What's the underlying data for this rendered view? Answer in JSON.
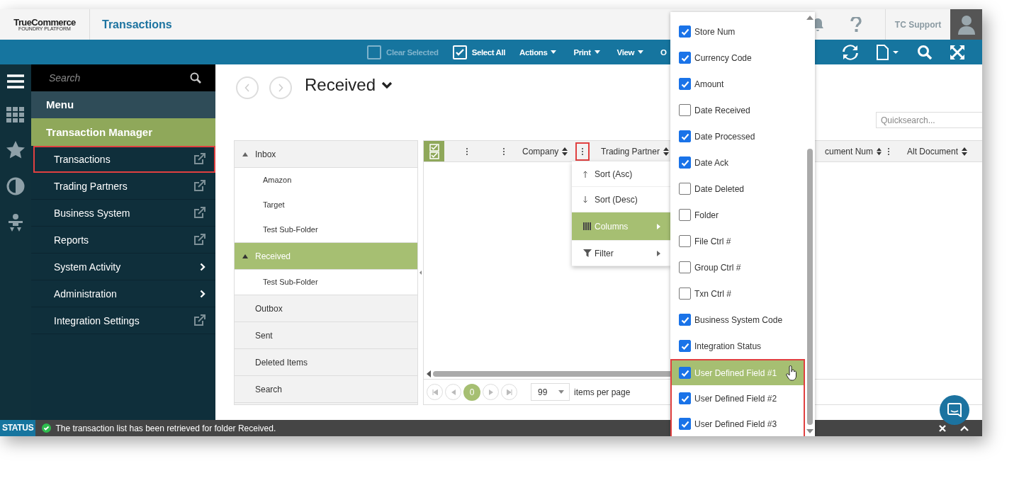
{
  "header": {
    "logo": "TrueCommerce",
    "logo_tagline": "FOUNDRY PLATFORM",
    "title": "Transactions",
    "user": "TC Support"
  },
  "toolbar": {
    "clear_selected": {
      "label": "Clear Selected",
      "checked": false,
      "disabled": true
    },
    "select_all": {
      "label": "Select All",
      "checked": true,
      "disabled": false
    },
    "menus": [
      "Actions",
      "Print",
      "View"
    ],
    "menu_cut": "O"
  },
  "sidebar": {
    "search_placeholder": "Search",
    "heading": "Menu",
    "section": "Transaction Manager",
    "items": [
      {
        "label": "Transactions",
        "kind": "external",
        "annotated": true
      },
      {
        "label": "Trading Partners",
        "kind": "external",
        "annotated": false
      },
      {
        "label": "Business System",
        "kind": "external",
        "annotated": false
      },
      {
        "label": "Reports",
        "kind": "external",
        "annotated": false
      },
      {
        "label": "System Activity",
        "kind": "submenu",
        "annotated": false
      },
      {
        "label": "Administration",
        "kind": "submenu",
        "annotated": false
      },
      {
        "label": "Integration Settings",
        "kind": "external",
        "annotated": false
      }
    ]
  },
  "folder_title": "Received",
  "quicksearch_placeholder": "Quicksearch...",
  "folders": [
    {
      "label": "Inbox",
      "expanded": true,
      "selected": false,
      "children": [
        {
          "label": "Amazon",
          "selected": false
        },
        {
          "label": "Target",
          "selected": false
        },
        {
          "label": "Test Sub-Folder",
          "selected": false
        }
      ]
    },
    {
      "label": "Received",
      "expanded": true,
      "selected": true,
      "children": [
        {
          "label": "Test Sub-Folder",
          "selected": false
        }
      ]
    },
    {
      "label": "Outbox",
      "selected": false
    },
    {
      "label": "Sent",
      "selected": false
    },
    {
      "label": "Deleted Items",
      "selected": false
    },
    {
      "label": "Search",
      "selected": false
    }
  ],
  "grid": {
    "select_all_checked": true,
    "columns": [
      {
        "kind": "full",
        "menu_open": false
      },
      {
        "kind": "full",
        "label": "Company",
        "menu_open": false
      },
      {
        "kind": "full",
        "label": "Trading Partner",
        "menu_open": true
      },
      {
        "kind": "cut",
        "label": "cument Num"
      },
      {
        "kind": "full",
        "label": "Alt Document",
        "menu_open": false
      }
    ],
    "pager": {
      "page": "0",
      "per_page": "99",
      "per_page_label": "items per page"
    }
  },
  "column_menu": [
    {
      "kind": "sort-asc",
      "label": "Sort (Asc)",
      "submenu": false,
      "selected": false
    },
    {
      "kind": "sort-desc",
      "label": "Sort (Desc)",
      "submenu": false,
      "selected": false
    },
    {
      "kind": "columns",
      "label": "Columns",
      "submenu": true,
      "selected": true
    },
    {
      "kind": "filter",
      "label": "Filter",
      "submenu": true,
      "selected": false
    }
  ],
  "column_chooser": [
    {
      "label": "Store Num",
      "checked": true,
      "selected": false,
      "annotated": false
    },
    {
      "label": "Currency Code",
      "checked": true,
      "selected": false,
      "annotated": false
    },
    {
      "label": "Amount",
      "checked": true,
      "selected": false,
      "annotated": false
    },
    {
      "label": "Date Received",
      "checked": false,
      "selected": false,
      "annotated": false
    },
    {
      "label": "Date Processed",
      "checked": true,
      "selected": false,
      "annotated": false
    },
    {
      "label": "Date Ack",
      "checked": true,
      "selected": false,
      "annotated": false
    },
    {
      "label": "Date Deleted",
      "checked": false,
      "selected": false,
      "annotated": false
    },
    {
      "label": "Folder",
      "checked": false,
      "selected": false,
      "annotated": false
    },
    {
      "label": "File Ctrl #",
      "checked": false,
      "selected": false,
      "annotated": false
    },
    {
      "label": "Group Ctrl #",
      "checked": false,
      "selected": false,
      "annotated": false
    },
    {
      "label": "Txn Ctrl #",
      "checked": false,
      "selected": false,
      "annotated": false
    },
    {
      "label": "Business System Code",
      "checked": true,
      "selected": false,
      "annotated": false
    },
    {
      "label": "Integration Status",
      "checked": true,
      "selected": false,
      "annotated": false
    },
    {
      "label": "User Defined Field #1",
      "checked": true,
      "selected": true,
      "annotated": true
    },
    {
      "label": "User Defined Field #2",
      "checked": true,
      "selected": false,
      "annotated": true
    },
    {
      "label": "User Defined Field #3",
      "checked": true,
      "selected": false,
      "annotated": true
    }
  ],
  "status_bar": {
    "label": "STATUS",
    "message": "The transaction list has been retrieved for folder Received."
  }
}
